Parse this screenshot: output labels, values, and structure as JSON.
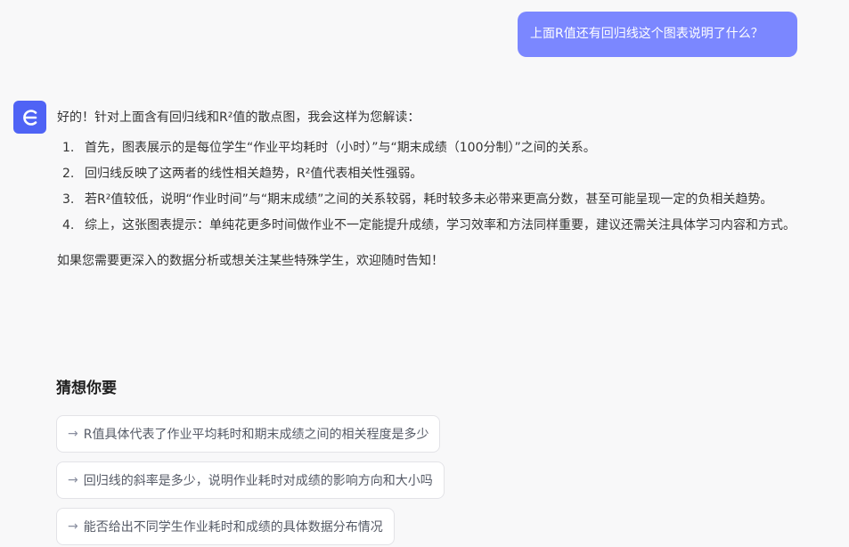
{
  "user_message": "上面R值还有回归线这个图表说明了什么？",
  "assistant": {
    "avatar_icon": "brand-e-logo-icon",
    "avatar_color": "#4f63f5",
    "intro": "好的！针对上面含有回归线和R²值的散点图，我会这样为您解读：",
    "points": [
      {
        "num": "1.",
        "text": "首先，图表展示的是每位学生“作业平均耗时（小时）”与“期末成绩（100分制）”之间的关系。"
      },
      {
        "num": "2.",
        "text": "回归线反映了这两者的线性相关趋势，R²值代表相关性强弱。"
      },
      {
        "num": "3.",
        "text": "若R²值较低，说明“作业时间”与“期末成绩”之间的关系较弱，耗时较多未必带来更高分数，甚至可能呈现一定的负相关趋势。"
      },
      {
        "num": "4.",
        "text": "综上，这张图表提示：单纯花更多时间做作业不一定能提升成绩，学习效率和方法同样重要，建议还需关注具体学习内容和方式。"
      }
    ],
    "outro": "如果您需要更深入的数据分析或想关注某些特殊学生，欢迎随时告知！"
  },
  "suggestions": {
    "title": "猜想你要",
    "arrow_glyph": "→",
    "items": [
      "R值具体代表了作业平均耗时和期末成绩之间的相关程度是多少",
      "回归线的斜率是多少，说明作业耗时对成绩的影响方向和大小吗",
      "能否给出不同学生作业耗时和成绩的具体数据分布情况"
    ]
  },
  "colors": {
    "user_bubble": "#7b87ff",
    "background": "#f8f8f9"
  }
}
